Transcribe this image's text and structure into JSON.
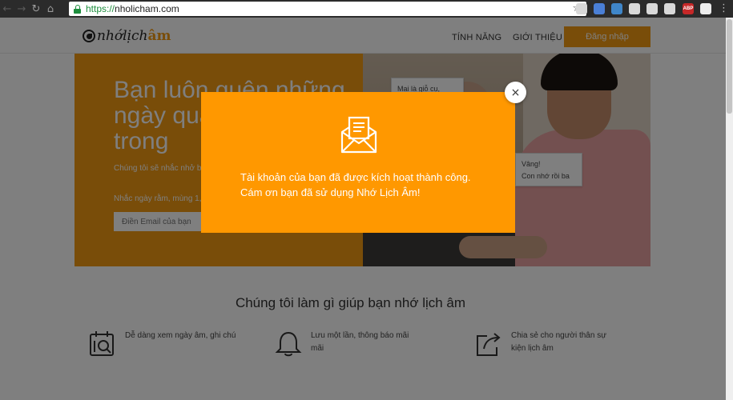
{
  "browser": {
    "url_scheme": "https://",
    "url_host": "nholicham.com",
    "icons": [
      "back-icon",
      "forward-icon",
      "reload-icon",
      "home-icon",
      "lock-icon",
      "star-icon",
      "menu-icon"
    ],
    "extensions": [
      {
        "name": "chat-extension-icon",
        "color": "#d8d8d8",
        "label": ""
      },
      {
        "name": "translate-extension-icon",
        "color": "#4a7fd6",
        "label": ""
      },
      {
        "name": "checker-extension-icon",
        "color": "#3f86c9",
        "label": ""
      },
      {
        "name": "shield-extension-icon",
        "color": "#d9d9d9",
        "label": ""
      },
      {
        "name": "puzzle-extension-icon",
        "color": "#d9d9d9",
        "label": ""
      },
      {
        "name": "window-extension-icon",
        "color": "#d9d9d9",
        "label": ""
      },
      {
        "name": "adblock-extension-icon",
        "color": "#c62828",
        "label": "ABP"
      },
      {
        "name": "circle-extension-icon",
        "color": "#ededed",
        "label": ""
      }
    ]
  },
  "header": {
    "logo_part1": "nhớ",
    "logo_part2": "lịch",
    "logo_part3": "âm",
    "nav_features": "TÍNH NĂNG",
    "nav_about": "GIỚI THIỆU",
    "login_label": "Đăng nhập"
  },
  "hero": {
    "title": "Bạn luôn quên những ngày quan trọng đại trong",
    "subtitle": "Chúng tôi sẽ nhắc nhở bạn",
    "remind": "Nhắc ngày rằm, mùng 1,",
    "email_placeholder": "Điền Email của bạn",
    "bubble1": "Mai là giỗ cụ,",
    "bubble2_line1": "Vâng!",
    "bubble2_line2": "Con nhớ rồi ba"
  },
  "features": {
    "section_title": "Chúng tôi làm gì giúp bạn nhớ lịch âm",
    "items": [
      {
        "text": "Dễ dàng xem ngày âm, ghi chú",
        "icon": "calendar-search-icon"
      },
      {
        "text": "Lưu một lần, thông báo mãi mãi",
        "icon": "bell-icon"
      },
      {
        "text": "Chia sẻ cho người thân sự kiện lịch âm",
        "icon": "share-icon"
      }
    ]
  },
  "modal": {
    "line1": "Tài khoản của bạn đã được kích hoạt thành công.",
    "line2": "Cám ơn bạn đã sử dụng Nhớ Lịch Âm!",
    "close_symbol": "×",
    "icon": "envelope-letter-icon"
  },
  "colors": {
    "brand_orange": "#f29a12",
    "modal_orange": "#ff9800"
  }
}
